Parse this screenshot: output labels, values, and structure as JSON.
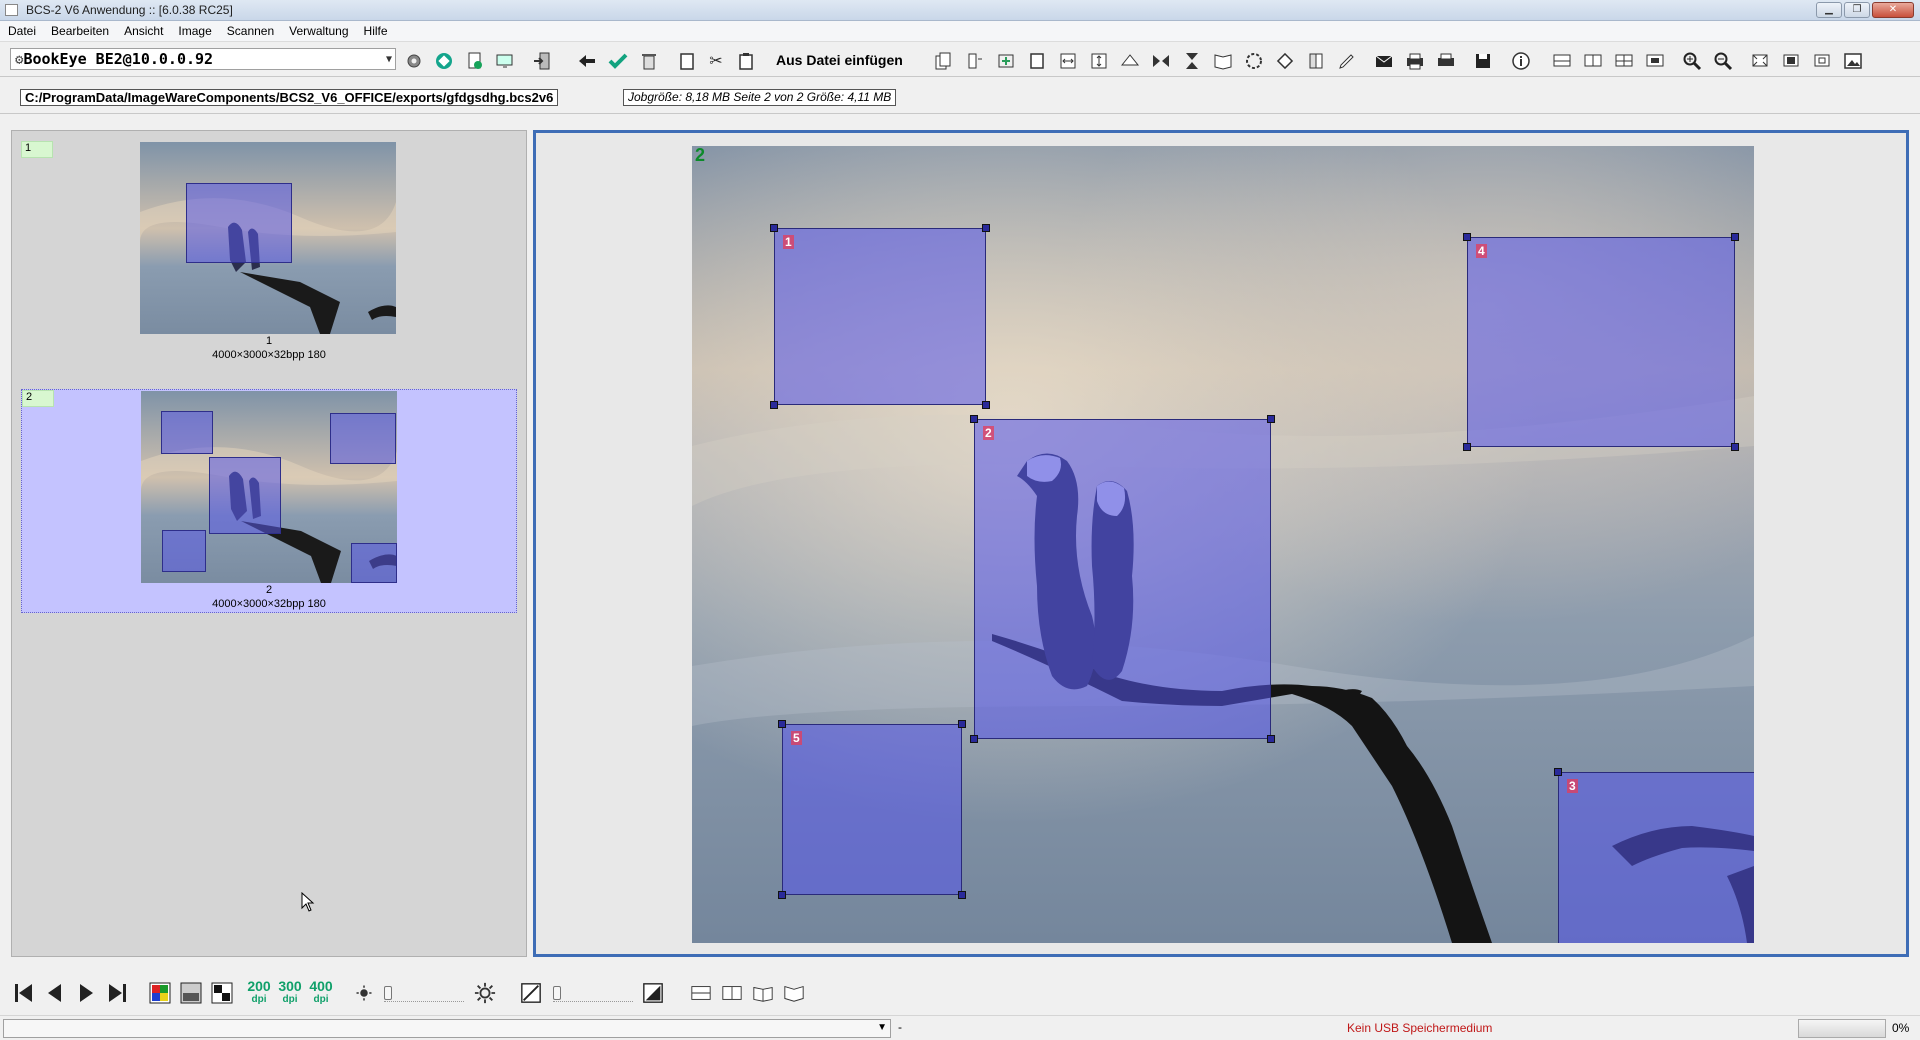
{
  "window": {
    "title": "BCS-2 V6 Anwendung :: [6.0.38 RC25]",
    "controls": [
      "minimize",
      "restore",
      "close"
    ]
  },
  "menu": [
    "Datei",
    "Bearbeiten",
    "Ansicht",
    "Image",
    "Scannen",
    "Verwaltung",
    "Hilfe"
  ],
  "toolbar": {
    "device": "BookEye BE2@10.0.0.92",
    "insert_from_file": "Aus Datei einfügen"
  },
  "pathbar": {
    "path": "C:/ProgramData/ImageWareComponents/BCS2_V6_OFFICE/exports/gfdgsdhg.bcs2v6",
    "job_info": "Jobgröße: 8,18 MB Seite 2 von 2 Größe: 4,11 MB"
  },
  "thumbnails": [
    {
      "badge": "1",
      "index": "1",
      "meta": "4000×3000×32bpp 180",
      "selected": false
    },
    {
      "badge": "2",
      "index": "2",
      "meta": "4000×3000×32bpp 180",
      "selected": true
    }
  ],
  "viewer": {
    "page_number": "2",
    "regions": [
      {
        "label": "1"
      },
      {
        "label": "2"
      },
      {
        "label": "3"
      },
      {
        "label": "4"
      },
      {
        "label": "5"
      }
    ]
  },
  "bottom": {
    "dpi_options": [
      {
        "value": "200",
        "unit": "dpi"
      },
      {
        "value": "300",
        "unit": "dpi"
      },
      {
        "value": "400",
        "unit": "dpi"
      }
    ]
  },
  "status": {
    "combo_value": "",
    "separator": "-",
    "message": "Kein USB Speichermedium",
    "progress": "0%"
  },
  "colors": {
    "selection_fill": "#5555eb",
    "selected_thumb_bg": "#c4c3ff",
    "viewer_border": "#3e6db6",
    "dpi_green": "#10a06a",
    "status_red": "#c01818"
  }
}
